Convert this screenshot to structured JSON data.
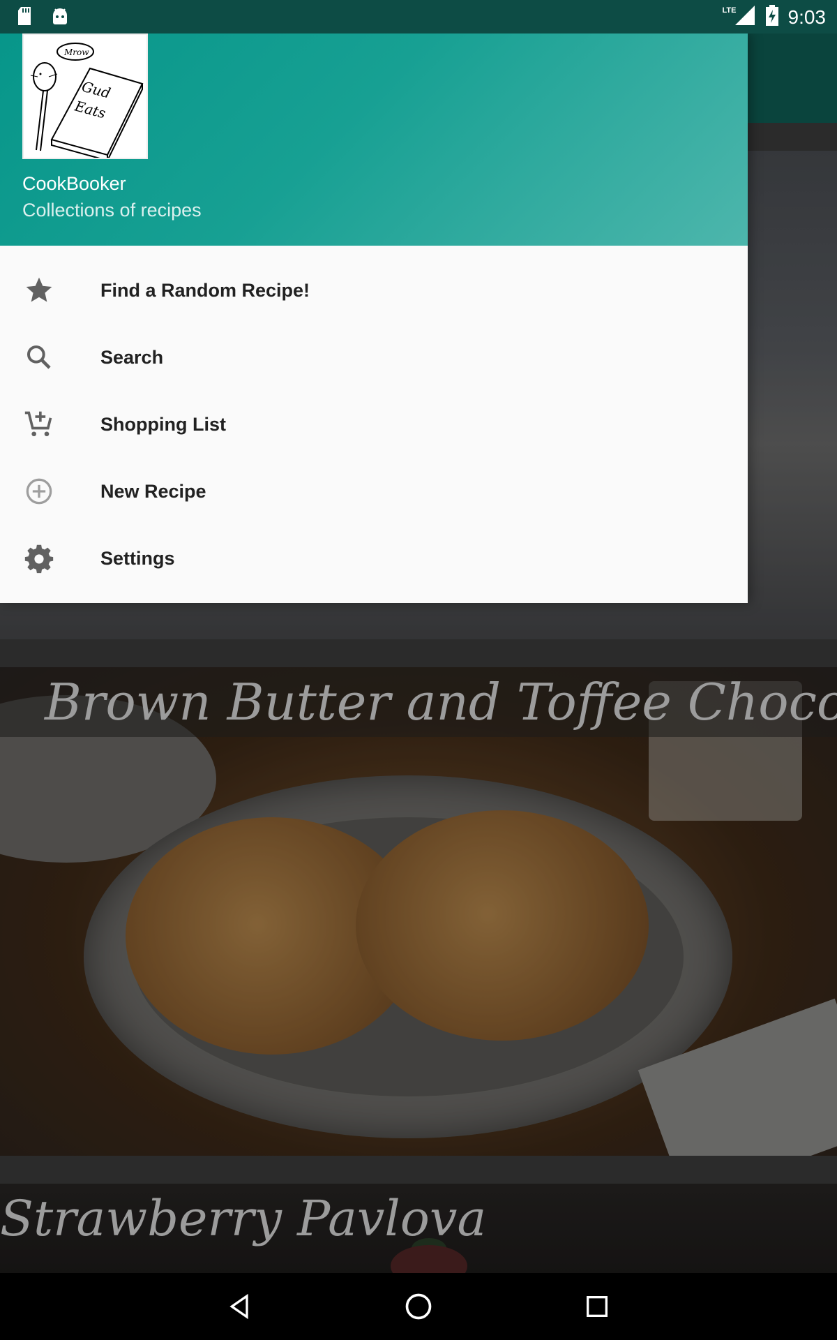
{
  "status_bar": {
    "time": "9:03",
    "network": "LTE",
    "icons": [
      "sd-card-icon",
      "android-icon",
      "signal-icon",
      "battery-charging-icon"
    ]
  },
  "drawer": {
    "header": {
      "app_name": "CookBooker",
      "subtitle": "Collections of recipes",
      "logo_text": [
        "Mrow",
        "Gud Eats"
      ]
    },
    "items": [
      {
        "label": "Find a Random Recipe!",
        "icon": "star-icon"
      },
      {
        "label": "Search",
        "icon": "search-icon"
      },
      {
        "label": "Shopping List",
        "icon": "add-shopping-cart-icon"
      },
      {
        "label": "New Recipe",
        "icon": "add-circle-icon"
      },
      {
        "label": "Settings",
        "icon": "gear-icon"
      }
    ]
  },
  "feed": {
    "recipes": [
      {
        "title": ""
      },
      {
        "title": "Brown Butter and Toffee Chocolate Chip"
      },
      {
        "title": "Strawberry Pavlova"
      }
    ]
  },
  "nav_bar": {
    "buttons": [
      "back-icon",
      "home-icon",
      "recents-icon"
    ]
  },
  "colors": {
    "status_bar": "#0d4c45",
    "app_bar": "#0e5f55",
    "drawer_header_start": "#07968a",
    "drawer_header_end": "#4db6ac",
    "drawer_bg": "#fafafa",
    "menu_icon": "#757575"
  }
}
